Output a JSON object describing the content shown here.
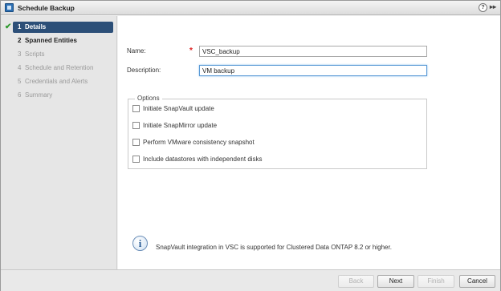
{
  "window": {
    "title": "Schedule Backup",
    "help_glyph": "?",
    "expand_glyph": "▸▸"
  },
  "sidebar": {
    "steps": [
      {
        "num": "1",
        "label": "Details",
        "state": "active"
      },
      {
        "num": "2",
        "label": "Spanned Entities",
        "state": "enabled"
      },
      {
        "num": "3",
        "label": "Scripts",
        "state": "disabled"
      },
      {
        "num": "4",
        "label": "Schedule and Retention",
        "state": "disabled"
      },
      {
        "num": "5",
        "label": "Credentials and Alerts",
        "state": "disabled"
      },
      {
        "num": "6",
        "label": "Summary",
        "state": "disabled"
      }
    ],
    "check_glyph": "✔"
  },
  "form": {
    "name_label": "Name:",
    "name_value": "VSC_backup",
    "required_marker": "*",
    "description_label": "Description:",
    "description_value": "VM backup",
    "options_legend": "Options",
    "options": [
      {
        "label": "Initiate SnapVault update",
        "checked": false
      },
      {
        "label": "Initiate SnapMirror update",
        "checked": false
      },
      {
        "label": "Perform VMware consistency snapshot",
        "checked": false
      },
      {
        "label": "Include datastores with independent disks",
        "checked": false
      }
    ]
  },
  "info": {
    "glyph": "i",
    "text": "SnapVault integration in VSC is supported for Clustered Data ONTAP 8.2 or higher."
  },
  "footer": {
    "back_label": "Back",
    "next_label": "Next",
    "finish_label": "Finish",
    "cancel_label": "Cancel"
  },
  "colors": {
    "active_step": "#2c4f78",
    "required": "#dd2222",
    "check": "#2e9a2e",
    "focus_border": "#5a9ad6"
  }
}
